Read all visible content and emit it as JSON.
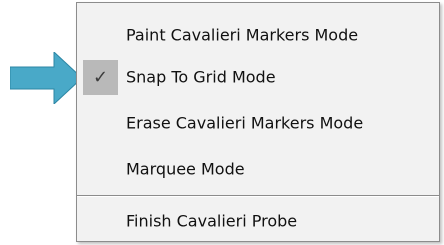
{
  "menu": {
    "items": [
      {
        "label": "Paint Cavalieri Markers Mode",
        "checked": false
      },
      {
        "label": "Snap To Grid Mode",
        "checked": true
      },
      {
        "label": "Erase Cavalieri Markers Mode",
        "checked": false
      },
      {
        "label": "Marquee Mode",
        "checked": false
      },
      {
        "label": "Finish Cavalieri Probe",
        "checked": false
      }
    ],
    "check_glyph": "✓"
  },
  "colors": {
    "menu_background": "#f2f2f2",
    "menu_border": "#8c8c8c",
    "check_highlight": "#b9b9b9",
    "arrow": "#49a9c8"
  },
  "icons": {
    "pointer": "arrow-right-icon",
    "check": "checkmark-icon"
  }
}
